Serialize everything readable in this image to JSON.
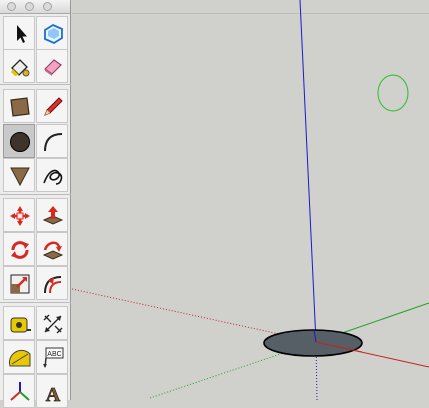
{
  "viewport": {
    "background": "#d0d0cc",
    "axes": {
      "blue": "#1a1acc",
      "red": "#c82020",
      "green": "#20a020"
    }
  },
  "palette": {
    "groups": [
      [
        "select",
        "make-component"
      ],
      [
        "paint-bucket",
        "eraser"
      ],
      [
        "rectangle",
        "line"
      ],
      [
        "circle",
        "arc"
      ],
      [
        "polygon",
        "freehand"
      ],
      [
        "move",
        "push-pull"
      ],
      [
        "rotate",
        "follow-me"
      ],
      [
        "scale",
        "offset"
      ],
      [
        "tape-measure",
        "dimension"
      ],
      [
        "protractor",
        "text"
      ],
      [
        "axes",
        "3d-text"
      ]
    ],
    "active_tool": "circle",
    "text_tool_label": "ABC",
    "text3d_label": "A"
  }
}
